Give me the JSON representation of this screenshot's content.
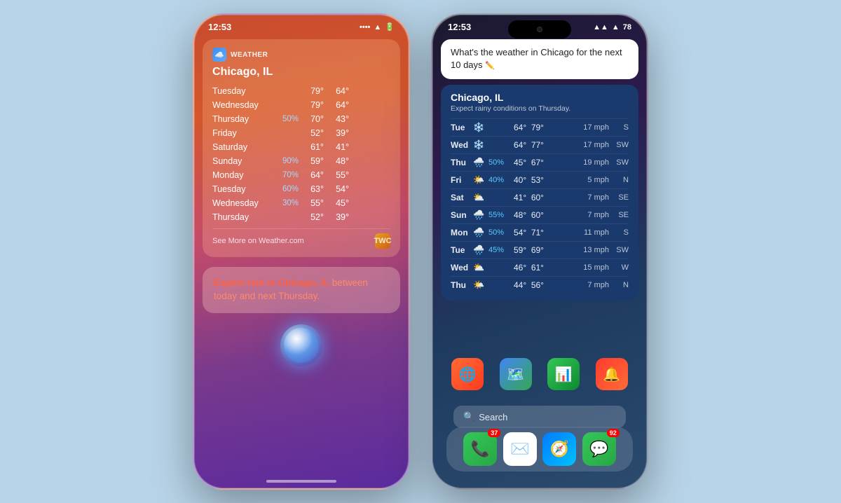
{
  "phone1": {
    "status_time": "12:53",
    "weather_label": "WEATHER",
    "city": "Chicago, IL",
    "forecast": [
      {
        "day": "Tuesday",
        "pct": "",
        "hi": "79°",
        "lo": "64°"
      },
      {
        "day": "Wednesday",
        "pct": "",
        "hi": "79°",
        "lo": "64°"
      },
      {
        "day": "Thursday",
        "pct": "50%",
        "hi": "70°",
        "lo": "43°"
      },
      {
        "day": "Friday",
        "pct": "",
        "hi": "52°",
        "lo": "39°"
      },
      {
        "day": "Saturday",
        "pct": "",
        "hi": "61°",
        "lo": "41°"
      },
      {
        "day": "Sunday",
        "pct": "90%",
        "hi": "59°",
        "lo": "48°"
      },
      {
        "day": "Monday",
        "pct": "70%",
        "hi": "64°",
        "lo": "55°"
      },
      {
        "day": "Tuesday",
        "pct": "60%",
        "hi": "63°",
        "lo": "54°"
      },
      {
        "day": "Wednesday",
        "pct": "30%",
        "hi": "55°",
        "lo": "45°"
      },
      {
        "day": "Thursday",
        "pct": "",
        "hi": "52°",
        "lo": "39°"
      }
    ],
    "see_more": "See More on Weather.com",
    "siri_text": "Expect rain in Chicago, IL between today and next Thursday."
  },
  "phone2": {
    "status_time": "12:53",
    "battery": "78",
    "query": "What's the weather in Chicago for the next 10 days",
    "city": "Chicago, IL",
    "subtitle": "Expect rainy conditions on Thursday.",
    "forecast": [
      {
        "day": "Tue",
        "icon": "❄️",
        "pct": "",
        "lo": "64°",
        "hi": "79°",
        "wind": "17 mph",
        "dir": "S"
      },
      {
        "day": "Wed",
        "icon": "❄️",
        "pct": "",
        "lo": "64°",
        "hi": "77°",
        "wind": "17 mph",
        "dir": "SW"
      },
      {
        "day": "Thu",
        "icon": "🌧️",
        "pct": "50%",
        "lo": "45°",
        "hi": "67°",
        "wind": "19 mph",
        "dir": "SW"
      },
      {
        "day": "Fri",
        "icon": "🌤️",
        "pct": "40%",
        "lo": "40°",
        "hi": "53°",
        "wind": "5 mph",
        "dir": "N"
      },
      {
        "day": "Sat",
        "icon": "⛅",
        "pct": "",
        "lo": "41°",
        "hi": "60°",
        "wind": "7 mph",
        "dir": "SE"
      },
      {
        "day": "Sun",
        "icon": "🌧️",
        "pct": "55%",
        "lo": "48°",
        "hi": "60°",
        "wind": "7 mph",
        "dir": "SE"
      },
      {
        "day": "Mon",
        "icon": "🌧️",
        "pct": "50%",
        "lo": "54°",
        "hi": "71°",
        "wind": "11 mph",
        "dir": "S"
      },
      {
        "day": "Tue",
        "icon": "🌧️",
        "pct": "45%",
        "lo": "59°",
        "hi": "69°",
        "wind": "13 mph",
        "dir": "SW"
      },
      {
        "day": "Wed",
        "icon": "⛅",
        "pct": "",
        "lo": "46°",
        "hi": "61°",
        "wind": "15 mph",
        "dir": "W"
      },
      {
        "day": "Thu",
        "icon": "🌤️",
        "pct": "",
        "lo": "44°",
        "hi": "56°",
        "wind": "7 mph",
        "dir": "N"
      }
    ],
    "search_label": "Search",
    "dock": {
      "phone_badge": "37",
      "messages_badge": "92"
    }
  }
}
